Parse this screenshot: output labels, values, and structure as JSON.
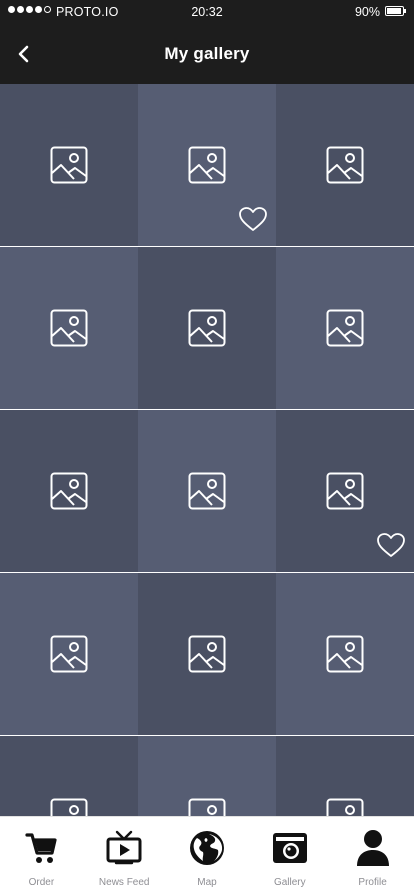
{
  "status_bar": {
    "carrier": "PROTO.IO",
    "time": "20:32",
    "battery": "90%",
    "signal_dots_filled": 4,
    "signal_dots_total": 5
  },
  "nav": {
    "title": "My gallery",
    "back_icon": "chevron-left-icon"
  },
  "gallery": {
    "tile_icon": "image-placeholder-icon",
    "colors": {
      "dark": "#4a5063",
      "light": "#565d73"
    },
    "tiles": [
      {
        "shade": "dark",
        "favorite": false
      },
      {
        "shade": "light",
        "favorite": true
      },
      {
        "shade": "dark",
        "favorite": false
      },
      {
        "shade": "light",
        "favorite": false
      },
      {
        "shade": "dark",
        "favorite": false
      },
      {
        "shade": "light",
        "favorite": false
      },
      {
        "shade": "dark",
        "favorite": false
      },
      {
        "shade": "light",
        "favorite": false
      },
      {
        "shade": "dark",
        "favorite": true
      },
      {
        "shade": "light",
        "favorite": false
      },
      {
        "shade": "dark",
        "favorite": false
      },
      {
        "shade": "light",
        "favorite": false
      },
      {
        "shade": "dark",
        "favorite": false
      },
      {
        "shade": "light",
        "favorite": false
      },
      {
        "shade": "dark",
        "favorite": false
      }
    ]
  },
  "tab_bar": {
    "tabs": [
      {
        "label": "Order",
        "icon": "cart-icon"
      },
      {
        "label": "News Feed",
        "icon": "tv-icon"
      },
      {
        "label": "Map",
        "icon": "globe-icon"
      },
      {
        "label": "Gallery",
        "icon": "camera-icon"
      },
      {
        "label": "Profile",
        "icon": "person-icon"
      }
    ]
  }
}
